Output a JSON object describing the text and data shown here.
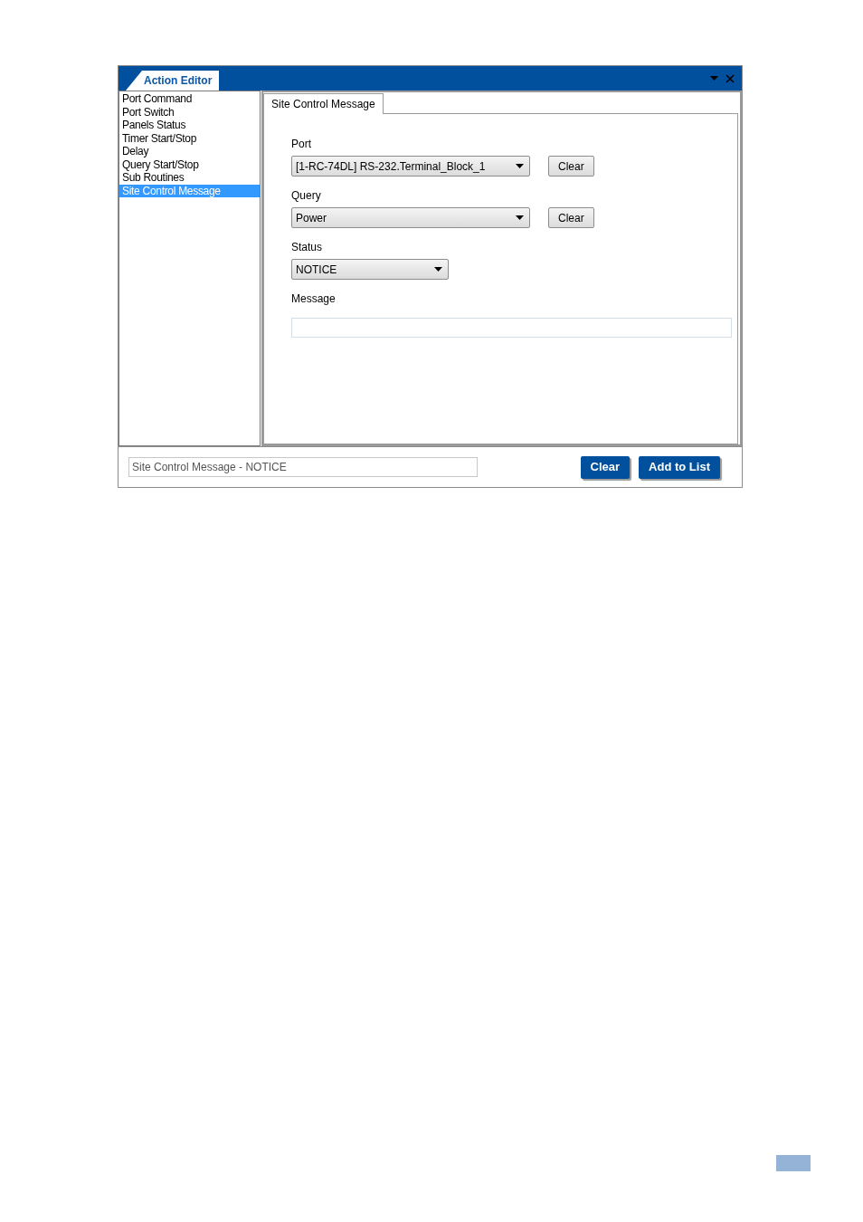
{
  "window": {
    "title": "Action Editor"
  },
  "action_list": [
    {
      "label": "Port Command",
      "selected": false
    },
    {
      "label": "Port Switch",
      "selected": false
    },
    {
      "label": "Panels Status",
      "selected": false
    },
    {
      "label": "Timer Start/Stop",
      "selected": false
    },
    {
      "label": "Delay",
      "selected": false
    },
    {
      "label": "Query Start/Stop",
      "selected": false
    },
    {
      "label": "Sub Routines",
      "selected": false
    },
    {
      "label": "Site Control Message",
      "selected": true
    }
  ],
  "tabs": [
    {
      "label": "Site Control Message",
      "selected": true
    }
  ],
  "form": [
    {
      "kind": "dropdown",
      "label": "Port",
      "value": "[1-RC-74DL] RS-232.Terminal_Block_1",
      "button": "Clear"
    },
    {
      "kind": "dropdown",
      "label": "Query",
      "value": "Power",
      "button": "Clear"
    },
    {
      "kind": "dropdown",
      "label": "Status",
      "value": "NOTICE"
    },
    {
      "kind": "text",
      "label": "Message"
    }
  ],
  "summary": {
    "value": "Site Control Message - NOTICE"
  },
  "buttons": [
    "Clear",
    "Add to List"
  ]
}
